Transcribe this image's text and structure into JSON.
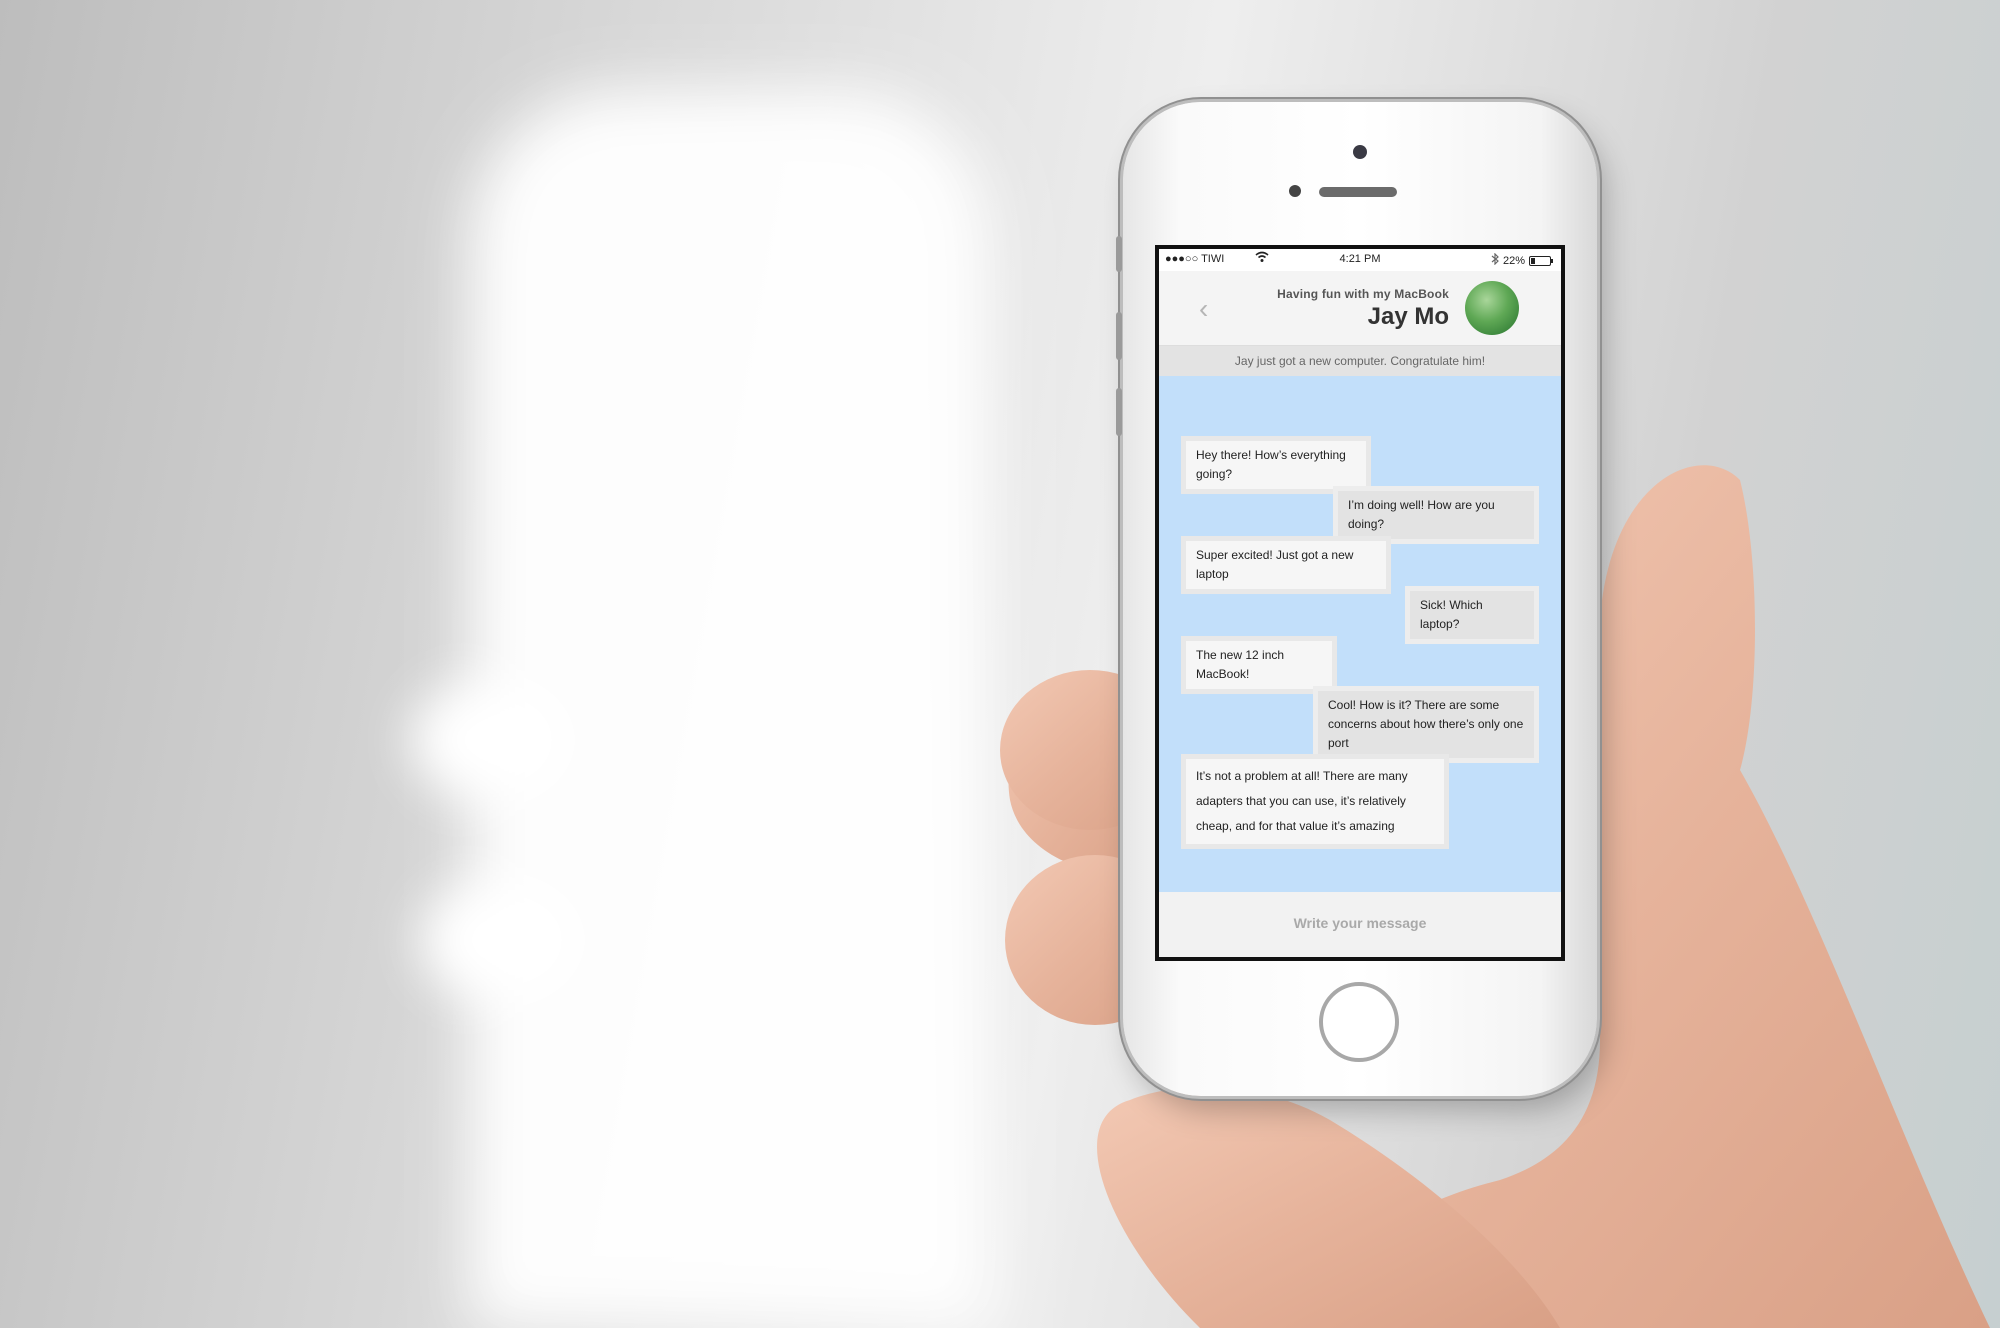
{
  "status_bar": {
    "carrier": "●●●○○ TIWI",
    "wifi_icon": "wifi-icon",
    "time": "4:21 PM",
    "bluetooth_icon": "bluetooth-icon",
    "battery_percent": "22%",
    "battery_level": 0.22
  },
  "header": {
    "subtitle": "Having fun with my MacBook",
    "title": "Jay Mo",
    "back_icon": "‹"
  },
  "banner": {
    "text": "Jay just got a new computer. Congratulate him!"
  },
  "messages": [
    {
      "text": "Hey there! How’s everything going?",
      "direction": "in"
    },
    {
      "text": "I’m doing well! How are you doing?",
      "direction": "out"
    },
    {
      "text": "Super excited! Just got a new laptop",
      "direction": "in"
    },
    {
      "text": "Sick! Which laptop?",
      "direction": "out"
    },
    {
      "text": "The new 12 inch MacBook!",
      "direction": "in"
    },
    {
      "text": "Cool! How is it? There are some concerns about  how there’s only one port",
      "direction": "out"
    },
    {
      "text": "It’s not a problem at all! There are many adapters that you can use, it’s relatively cheap, and for that value it’s amazing",
      "direction": "in"
    }
  ],
  "composer": {
    "placeholder": "Write your message"
  },
  "colors": {
    "chat_background": "#c2dffa",
    "bubble_in": "#f6f6f6",
    "bubble_out": "#e3e3e3",
    "avatar": "#5fa855"
  }
}
